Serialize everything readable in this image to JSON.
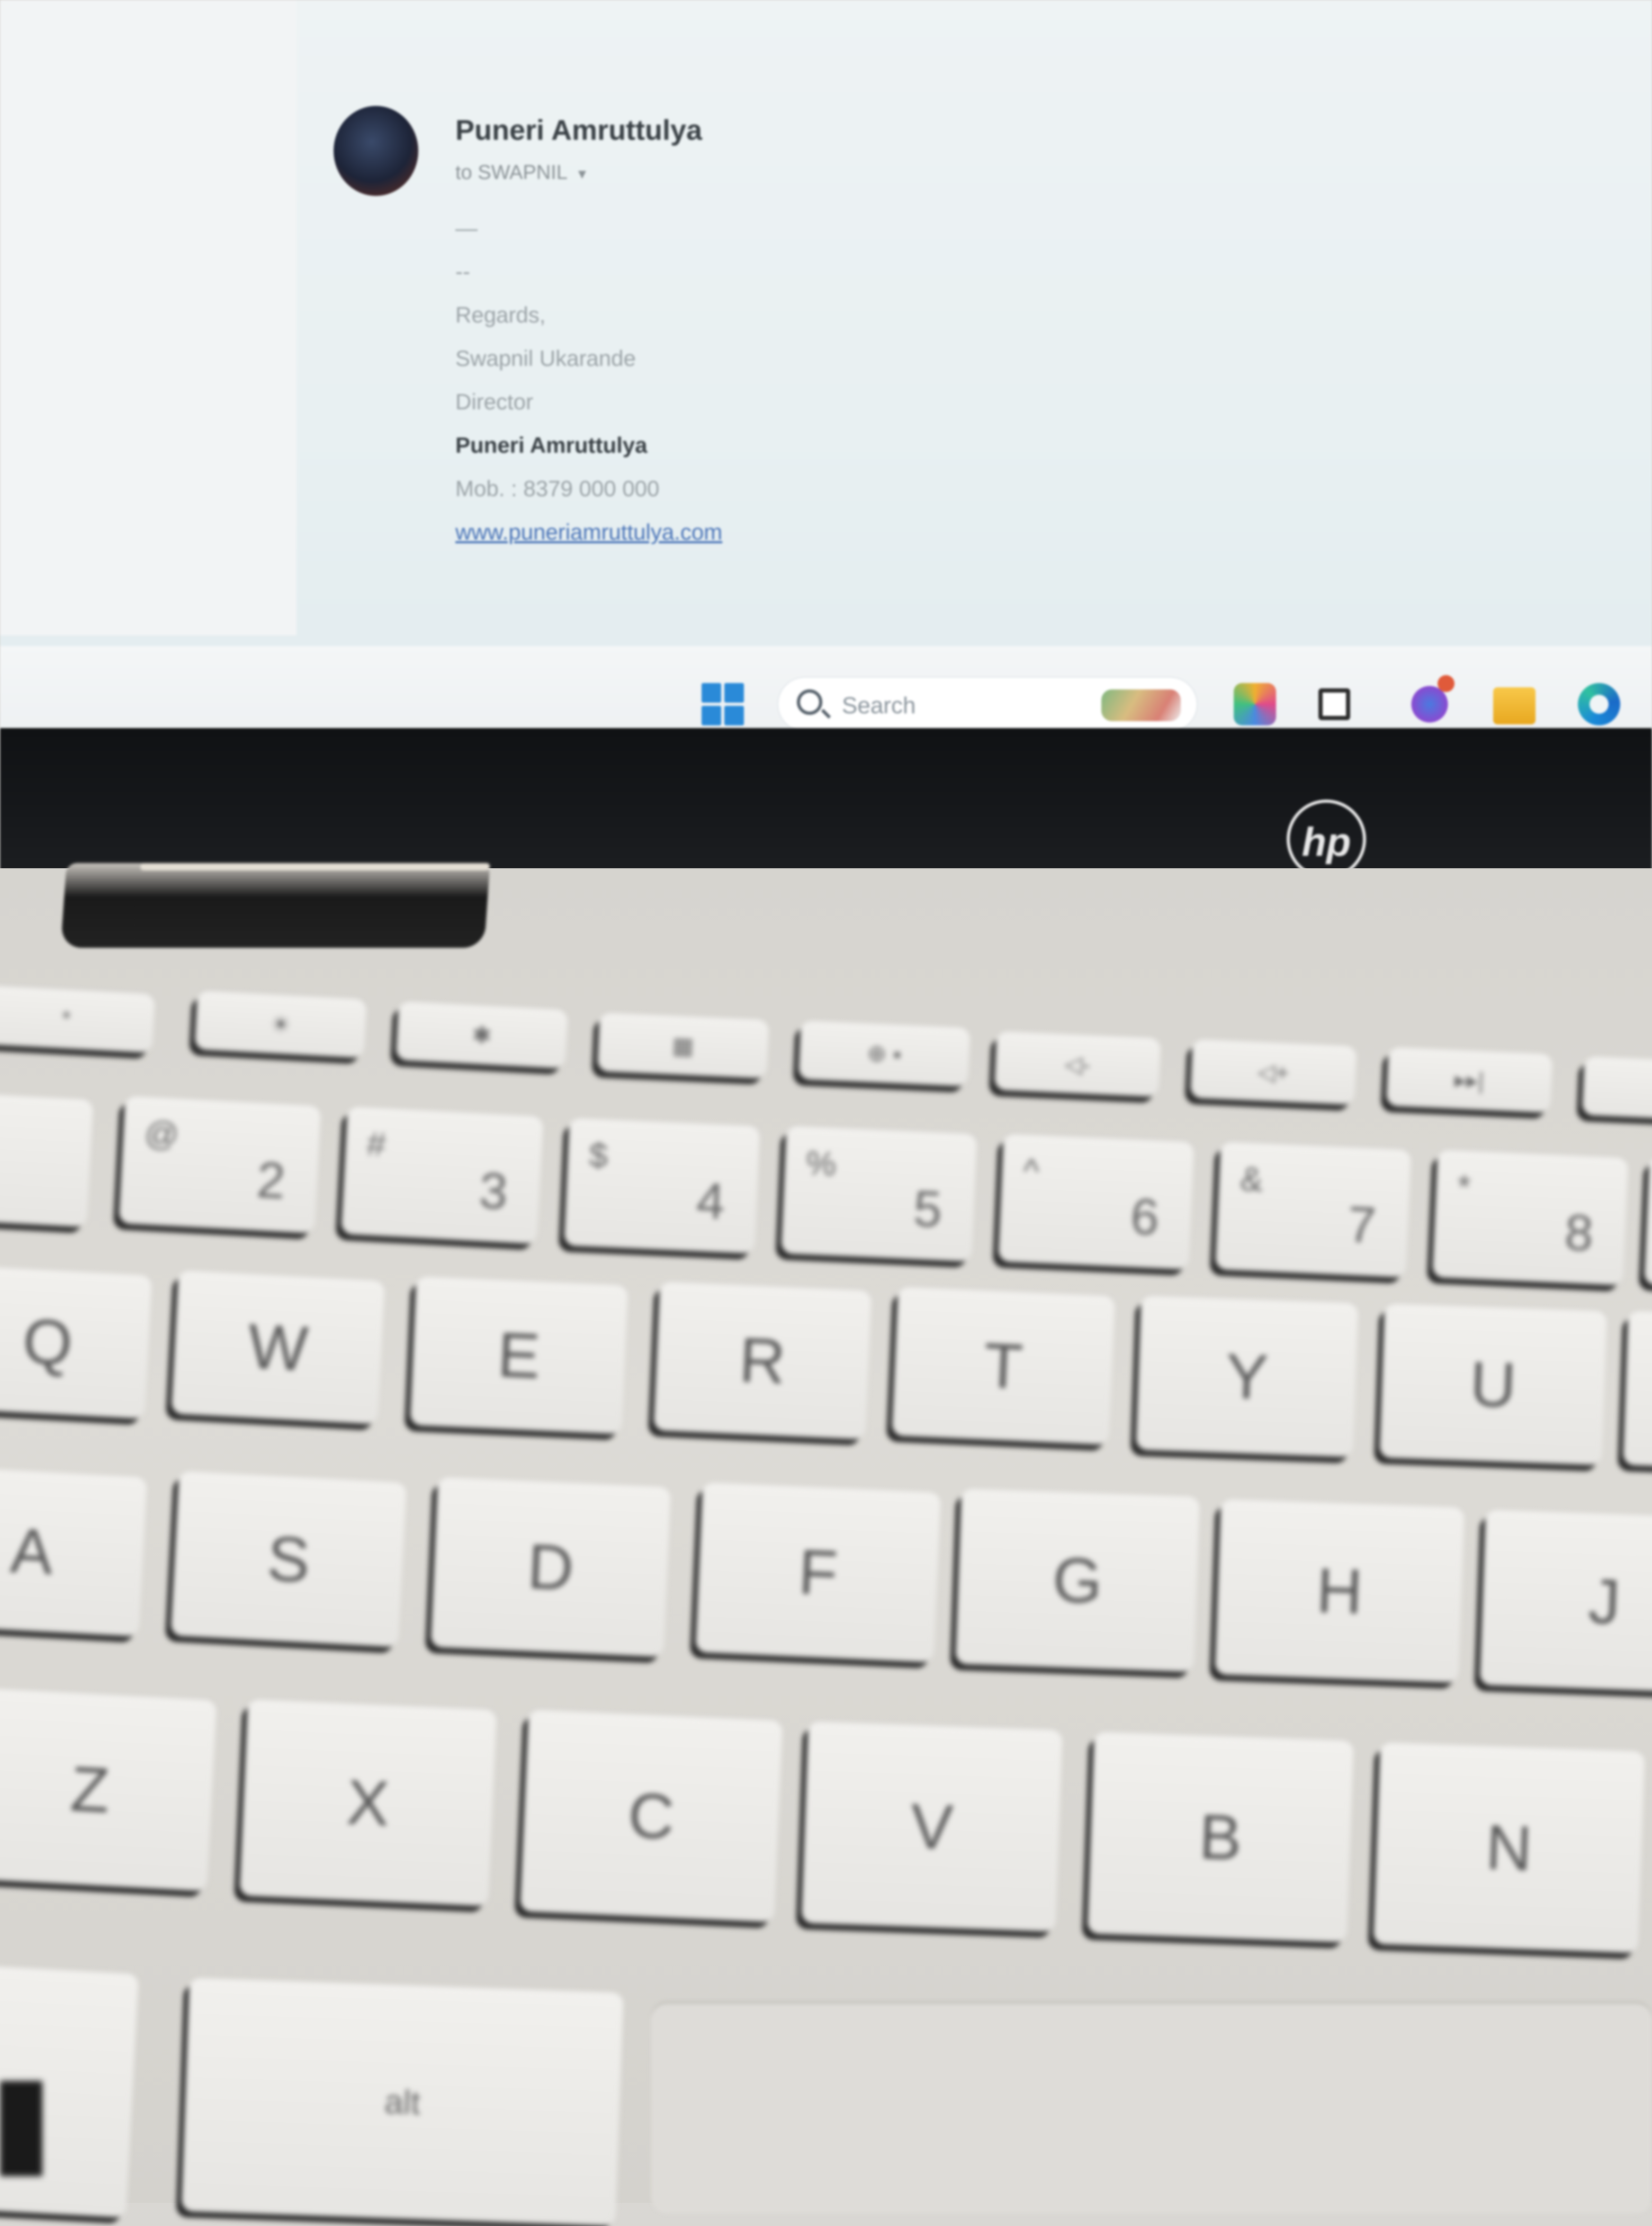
{
  "email": {
    "sender": "Puneri Amruttulya",
    "to": "to SWAPNIL",
    "preview": "—",
    "separator": "--",
    "signature": {
      "greeting": "Regards,",
      "name": "Swapnil Ukarande",
      "title": "Director",
      "company": "Puneri Amruttulya",
      "mobile": "Mob. : 8379 000 000",
      "website": "www.puneriamruttulya.com"
    }
  },
  "taskbar": {
    "search_placeholder": "Search",
    "apps": [
      "windows-start-icon",
      "search-icon",
      "copilot-icon",
      "task-view-icon",
      "teams-icon",
      "file-explorer-icon",
      "edge-icon"
    ]
  },
  "brand": {
    "logo_text": "hp"
  },
  "keyboard": {
    "fn_row": [
      "*",
      "☀",
      "✱",
      "▦",
      "⊕ ▪",
      "◁-",
      "◁+",
      "▸▸|"
    ],
    "number_row": [
      {
        "main": "2",
        "sub": "@"
      },
      {
        "main": "3",
        "sub": "#"
      },
      {
        "main": "4",
        "sub": "$"
      },
      {
        "main": "5",
        "sub": "%"
      },
      {
        "main": "6",
        "sub": "^"
      },
      {
        "main": "7",
        "sub": "&"
      },
      {
        "main": "8",
        "sub": "*"
      }
    ],
    "qwerty_row": [
      "Q",
      "W",
      "E",
      "R",
      "T",
      "Y",
      "U"
    ],
    "home_row": [
      "A",
      "S",
      "D",
      "F",
      "G",
      "H",
      "J"
    ],
    "bottom_row": [
      "Z",
      "X",
      "C",
      "V",
      "B",
      "N"
    ],
    "modifier": "alt"
  }
}
